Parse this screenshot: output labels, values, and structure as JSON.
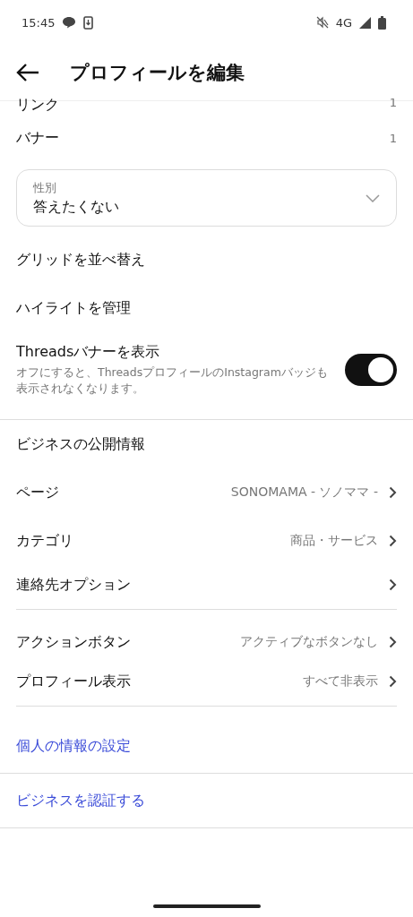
{
  "status_bar": {
    "time": "15:45",
    "network": "4G"
  },
  "header": {
    "title": "プロフィールを編集"
  },
  "items": [
    {
      "kind": "value",
      "label": "リンク",
      "value": "1"
    },
    {
      "kind": "value",
      "label": "バナー",
      "value": "1"
    },
    {
      "kind": "dropdown",
      "label": "性別",
      "value": "答えたくない"
    },
    {
      "kind": "link",
      "label": "グリッドを並べ替え"
    },
    {
      "kind": "link",
      "label": "ハイライトを管理"
    },
    {
      "kind": "toggle",
      "label": "Threadsバナーを表示",
      "description": "オフにすると、ThreadsプロフィールのInstagramバッジも表示されなくなります。",
      "on": true
    },
    {
      "kind": "divider"
    },
    {
      "kind": "section",
      "label": "ビジネスの公開情報"
    },
    {
      "kind": "nav",
      "label": "ページ",
      "value": "SONOMAMA - ソノママ -"
    },
    {
      "kind": "nav",
      "label": "カテゴリ",
      "value": "商品・サービス"
    },
    {
      "kind": "nav",
      "label": "連絡先オプション"
    },
    {
      "kind": "divider"
    },
    {
      "kind": "nav",
      "label": "アクションボタン",
      "value": "アクティブなボタンなし"
    },
    {
      "kind": "nav",
      "label": "プロフィール表示",
      "value": "すべて非表示"
    },
    {
      "kind": "divider"
    },
    {
      "kind": "action",
      "label": "個人の情報の設定"
    },
    {
      "kind": "divider"
    },
    {
      "kind": "action",
      "label": "ビジネスを認証する"
    },
    {
      "kind": "divider"
    }
  ]
}
